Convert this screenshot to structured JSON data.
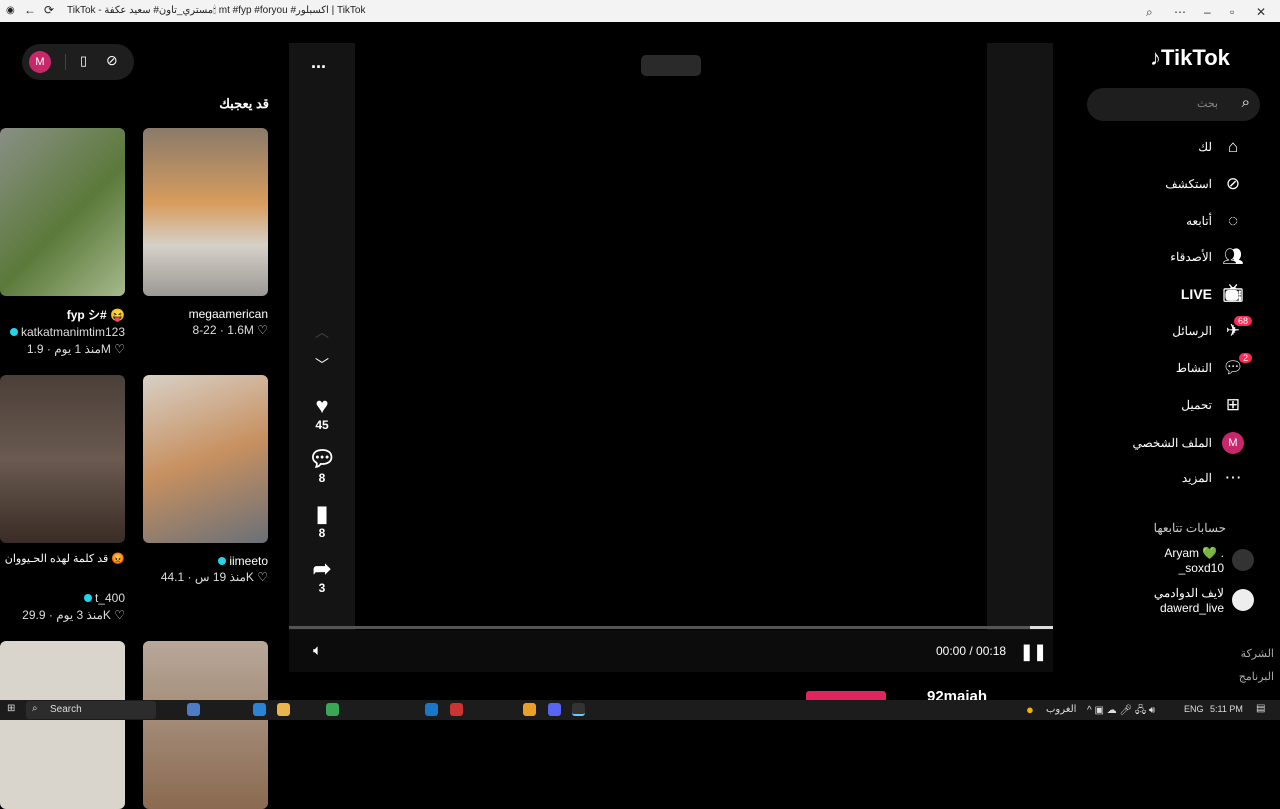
{
  "window": {
    "title": "TikTok - مستري_تاون# سعيد عكفة🕯 mt #fyp #foryou #اكسبلور | TikTok"
  },
  "left": {
    "avatar_letter": "M",
    "heading": "قد يعجبك",
    "videos": [
      {
        "title": "fyp シ# 😝",
        "author": "katkatmanimtim123",
        "likes": "1.9M",
        "date": "منذ 1 يوم"
      },
      {
        "title": "",
        "author": "megaamerican",
        "likes": "1.6M",
        "date": "8-22"
      },
      {
        "title": "قد كلمة لهذه الحـيووان 😡",
        "author": "t_400",
        "likes": "29.9K",
        "date": "منذ 3 يوم"
      },
      {
        "title": "",
        "author": "iimeeto",
        "likes": "44.1K",
        "date": "منذ 19 س"
      }
    ]
  },
  "player": {
    "more": "...",
    "likes": "45",
    "comments": "8",
    "saves": "8",
    "shares": "3",
    "time": "00:00 / 00:18",
    "progress": 0.97,
    "next_author": "92maiah"
  },
  "sidebar": {
    "logo": "TikTok",
    "search_placeholder": "بحث",
    "nav": [
      {
        "label": "لك"
      },
      {
        "label": "استكشف"
      },
      {
        "label": "أتابعه"
      },
      {
        "label": "الأصدقاء"
      },
      {
        "label": "LIVE"
      },
      {
        "label": "الرسائل",
        "badge": "68"
      },
      {
        "label": "النشاط",
        "badge": "2"
      },
      {
        "label": "تحميل"
      },
      {
        "label": "الملف الشخصي"
      },
      {
        "label": "المزيد"
      }
    ],
    "following_heading": "حسابات تتابعها",
    "following": [
      {
        "name": "Aryam 💚 .",
        "handle": "_soxd10"
      },
      {
        "name": "لايف الدوادمي",
        "handle": "dawerd_live"
      }
    ],
    "footer": [
      "الشركة",
      "البرنامج"
    ]
  },
  "taskbar": {
    "search": "Search",
    "weather": "الغروب",
    "lang": "ENG",
    "time": "5:11 PM"
  }
}
